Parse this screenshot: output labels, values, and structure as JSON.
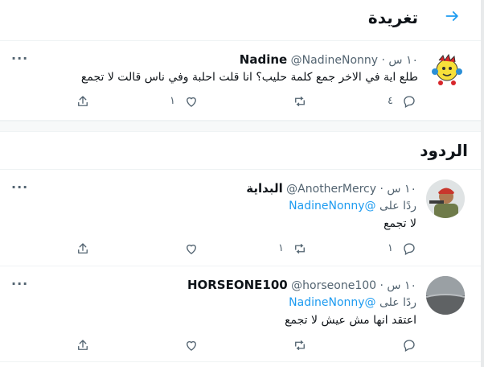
{
  "header": {
    "title": "تغريدة",
    "back_icon": "arrow-right-icon"
  },
  "main_tweet": {
    "name": "Nadine",
    "handle": "@NadineNonny",
    "time": "١٠ س",
    "text": "طلع اية في الاخر جمع كلمة حليب؟ انا قلت احلبة وفي ناس قالت لا تجمع",
    "replies": "٤",
    "retweets": "",
    "likes": "١"
  },
  "replies_section": {
    "title": "الردود"
  },
  "replies": [
    {
      "name": "البداية",
      "handle": "@AnotherMercy",
      "time": "١٠ س",
      "replying_label": "ردًا على",
      "replying_handle": "@NadineNonny",
      "text": "لا تجمع",
      "replies": "١",
      "retweets": "١",
      "likes": ""
    },
    {
      "name": "HORSEONE100",
      "handle": "@horseone100",
      "time": "١٠ س",
      "replying_label": "ردًا على",
      "replying_handle": "@NadineNonny",
      "text": "اعتقد انها مش عيش لا تجمع",
      "replies": "",
      "retweets": "",
      "likes": ""
    }
  ]
}
